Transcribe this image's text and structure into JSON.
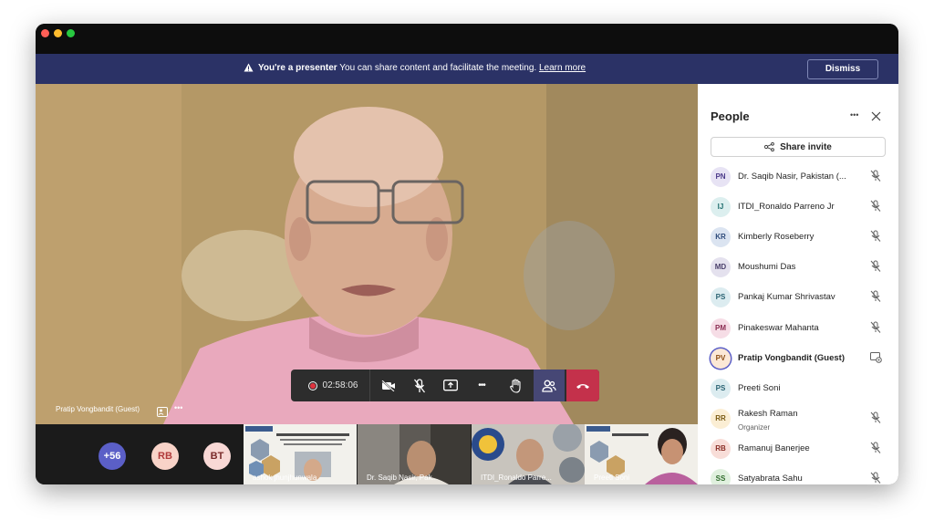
{
  "banner": {
    "bold": "You're a presenter",
    "text": "You can share content and facilitate the meeting.",
    "link": "Learn more",
    "dismiss": "Dismiss"
  },
  "stage": {
    "speaker_name": "Pratip Vongbandit (Guest)"
  },
  "controls": {
    "timer": "02:58:06",
    "more": "•••"
  },
  "strip": {
    "overflow_count": "+56",
    "avatars": [
      "RB",
      "BT"
    ],
    "tiles": [
      {
        "name": "ashok jhunjhunwala"
      },
      {
        "name": "Dr. Saqib Nasir, Pak..."
      },
      {
        "name": "ITDI_Ronaldo Parre..."
      },
      {
        "name": "Preeti Soni"
      }
    ]
  },
  "panel": {
    "title": "People",
    "share_label": "Share invite",
    "people": [
      {
        "initials": "PN",
        "name": "Dr. Saqib Nasir, Pakistan (...",
        "role": ""
      },
      {
        "initials": "IJ",
        "name": "ITDI_Ronaldo Parreno Jr",
        "role": ""
      },
      {
        "initials": "KR",
        "name": "Kimberly Roseberry",
        "role": ""
      },
      {
        "initials": "MD",
        "name": "Moushumi Das",
        "role": ""
      },
      {
        "initials": "PS",
        "name": "Pankaj Kumar Shrivastav",
        "role": ""
      },
      {
        "initials": "PM",
        "name": "Pinakeswar Mahanta",
        "role": ""
      },
      {
        "initials": "PV",
        "name": "Pratip Vongbandit (Guest)",
        "role": ""
      },
      {
        "initials": "PS",
        "name": "Preeti Soni",
        "role": ""
      },
      {
        "initials": "RR",
        "name": "Rakesh Raman",
        "role": "Organizer"
      },
      {
        "initials": "RB",
        "name": "Ramanuj Banerjee",
        "role": ""
      },
      {
        "initials": "SS",
        "name": "Satyabrata Sahu",
        "role": ""
      }
    ]
  },
  "colors": {
    "banner_bg": "#2b3266",
    "hangup": "#c4314b",
    "accent": "#5b5fc7"
  }
}
